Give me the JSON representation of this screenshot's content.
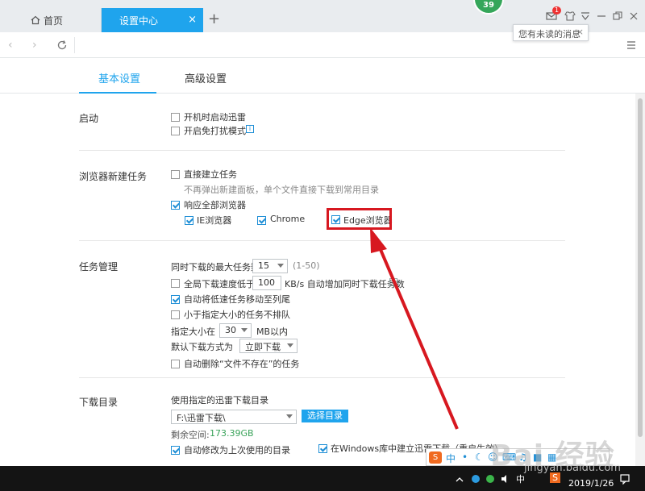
{
  "browser": {
    "tabs": [
      {
        "label": "首页",
        "icon": "home-icon",
        "active": false
      },
      {
        "label": "设置中心",
        "icon": "",
        "active": true
      }
    ],
    "new_tab_label": "+",
    "close_glyph": "×",
    "badge_value": "39",
    "notification_count": "1",
    "tooltip_text": "您有未读的消息",
    "accent_color": "#1fa4ed"
  },
  "settings_tabs": [
    {
      "label": "基本设置",
      "active": true
    },
    {
      "label": "高级设置",
      "active": false
    }
  ],
  "sections": {
    "startup": {
      "title": "启动",
      "options": [
        {
          "label": "开机时启动迅雷",
          "checked": false
        },
        {
          "label": "开启免打扰模式",
          "checked": false,
          "info": "i"
        }
      ]
    },
    "browser_tasks": {
      "title": "浏览器新建任务",
      "direct_create": {
        "label": "直接建立任务",
        "checked": false
      },
      "direct_hint": "不再弹出新建面板，单个文件直接下载到常用目录",
      "respond_all": {
        "label": "响应全部浏览器",
        "checked": true
      },
      "browsers": [
        {
          "label": "IE浏览器",
          "checked": true
        },
        {
          "label": "Chrome",
          "checked": true
        },
        {
          "label": "Edge浏览器",
          "checked": true
        }
      ]
    },
    "task_mgmt": {
      "title": "任务管理",
      "max_tasks_label": "同时下载的最大任务数",
      "max_tasks_value": "15",
      "max_tasks_range": "(1-50)",
      "speed_label": "全局下载速度低于",
      "speed_value": "100",
      "speed_suffix": "KB/s 自动增加同时下载任务数",
      "speed_checked": false,
      "move_slow": {
        "label": "自动将低速任务移动至列尾",
        "checked": true
      },
      "small_noqueue": {
        "label": "小于指定大小的任务不排队",
        "checked": false
      },
      "size_label": "指定大小在",
      "size_value": "30",
      "size_unit": "MB以内",
      "default_mode_label": "默认下载方式为",
      "default_mode_value": "立即下载",
      "auto_delete": {
        "label": "自动删除“文件不存在”的任务",
        "checked": false
      }
    },
    "download_dir": {
      "title": "下载目录",
      "use_dir_label": "使用指定的迅雷下载目录",
      "dir_value": "F:\\迅雷下载\\",
      "choose_btn": "选择目录",
      "free_label": "剩余空间:",
      "free_value": "173.39GB",
      "auto_modify": {
        "label": "自动修改为上次使用的目录",
        "checked": true
      },
      "win_lib": {
        "label": "在Windows库中建立迅雷下载（重启生效）",
        "checked": true
      }
    }
  },
  "ime_bar": {
    "logo": "S",
    "lang": "中"
  },
  "taskbar": {
    "ime_lang": "中",
    "app_label": "S",
    "date": "2019/1/26"
  },
  "watermark": {
    "main": "Bai 经验",
    "sub": "jingyan.baidu.com"
  }
}
